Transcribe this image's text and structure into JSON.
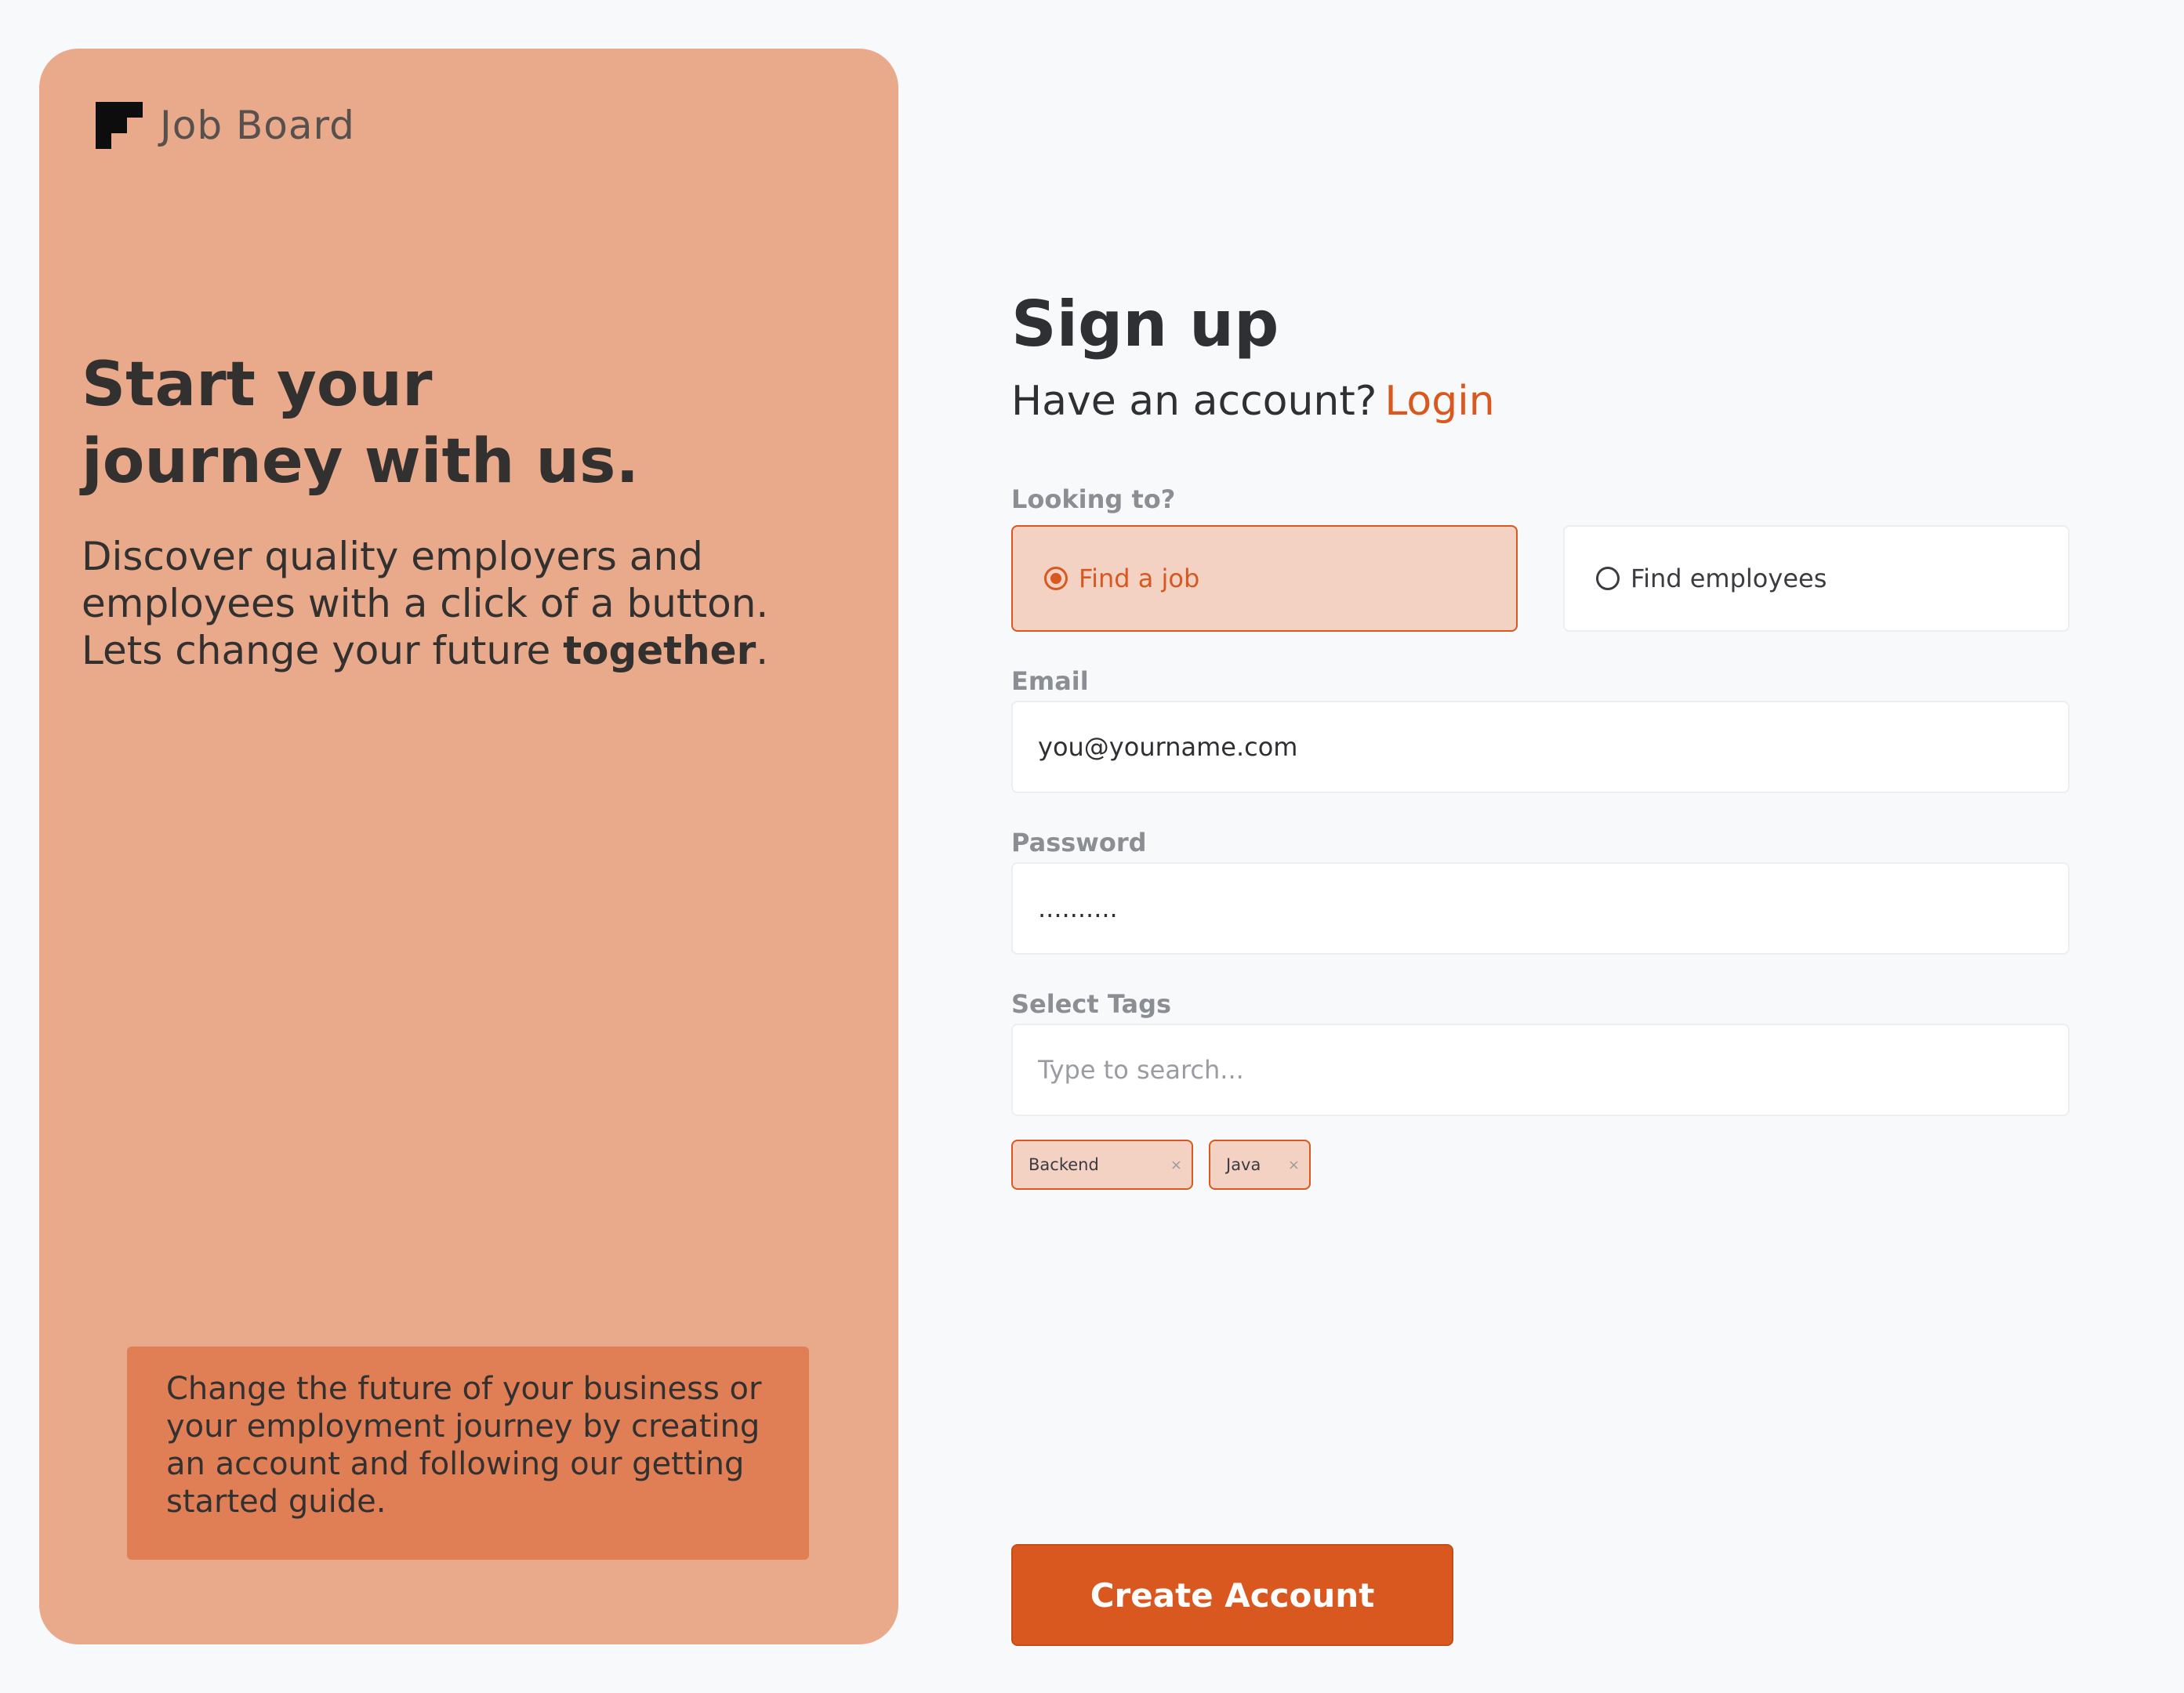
{
  "brand": {
    "name": "Job Board",
    "logo_icon": "stair-step-logo"
  },
  "hero": {
    "title_line1": "Start your",
    "title_line2": "journey with us.",
    "desc_line1": "Discover quality employers and",
    "desc_line2": "employees with a click of a button.",
    "desc_line3_prefix": "Lets change your future ",
    "desc_line3_bold": "together",
    "desc_line3_suffix": "."
  },
  "callout": {
    "text": "Change the future of your business or your employment journey by creating an account and following our getting started guide."
  },
  "form": {
    "title": "Sign up",
    "have_account": "Have an account?",
    "login_label": "Login",
    "looking_label": "Looking to?",
    "options": [
      {
        "label": "Find a job",
        "selected": true
      },
      {
        "label": "Find employees",
        "selected": false
      }
    ],
    "email_label": "Email",
    "email_value": "you@yourname.com",
    "password_label": "Password",
    "password_value": "..........",
    "tags_label": "Select Tags",
    "tags_placeholder": "Type to search...",
    "tags": [
      {
        "label": "Backend",
        "remove": "×"
      },
      {
        "label": "Java",
        "remove": "×"
      }
    ],
    "submit_label": "Create Account"
  },
  "colors": {
    "accent": "#d9581f",
    "panel_bg": "#e9a98b",
    "callout_bg": "#e07f56",
    "selected_bg": "#f3d1c3",
    "page_bg": "#f8f9fb"
  }
}
